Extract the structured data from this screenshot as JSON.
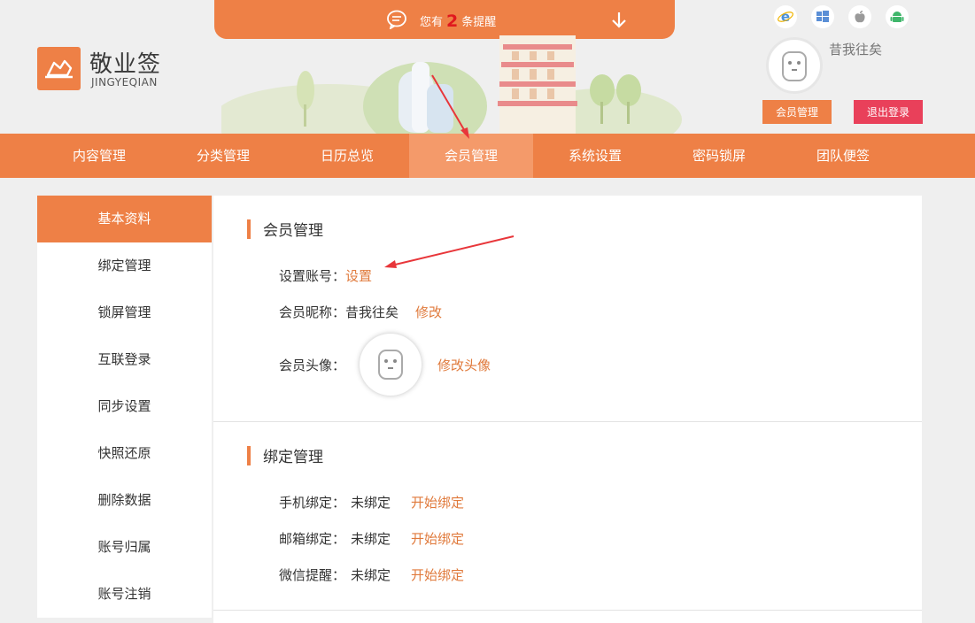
{
  "notification": {
    "prefix": "您有",
    "count": "2",
    "suffix": "条提醒"
  },
  "logo": {
    "name": "敬业签",
    "subtitle": "JINGYEQIAN"
  },
  "platform_icons": [
    "ie-icon",
    "windows-icon",
    "apple-icon",
    "android-icon"
  ],
  "user": {
    "name": "昔我往矣",
    "member_button": "会员管理",
    "logout_button": "退出登录"
  },
  "nav": {
    "items": [
      {
        "label": "内容管理"
      },
      {
        "label": "分类管理"
      },
      {
        "label": "日历总览"
      },
      {
        "label": "会员管理"
      },
      {
        "label": "系统设置"
      },
      {
        "label": "密码锁屏"
      },
      {
        "label": "团队便签"
      }
    ],
    "active_index": 3
  },
  "sidebar": {
    "items": [
      {
        "label": "基本资料"
      },
      {
        "label": "绑定管理"
      },
      {
        "label": "锁屏管理"
      },
      {
        "label": "互联登录"
      },
      {
        "label": "同步设置"
      },
      {
        "label": "快照还原"
      },
      {
        "label": "删除数据"
      },
      {
        "label": "账号归属"
      },
      {
        "label": "账号注销"
      }
    ],
    "active_index": 0
  },
  "member_section": {
    "title": "会员管理",
    "account_label": "设置账号：",
    "account_link": "设置",
    "nickname_label": "会员昵称：",
    "nickname_value": "昔我往矣",
    "nickname_link": "修改",
    "avatar_label": "会员头像：",
    "avatar_link": "修改头像"
  },
  "binding_section": {
    "title": "绑定管理",
    "rows": [
      {
        "label": "手机绑定：",
        "value": "未绑定",
        "link": "开始绑定"
      },
      {
        "label": "邮箱绑定：",
        "value": "未绑定",
        "link": "开始绑定"
      },
      {
        "label": "微信提醒：",
        "value": "未绑定",
        "link": "开始绑定"
      }
    ]
  },
  "colors": {
    "accent": "#ee8046",
    "accent_light": "#f49a6a",
    "logout": "#e9405a",
    "link": "#e07a3c",
    "annotation_arrow": "#e8363a"
  }
}
